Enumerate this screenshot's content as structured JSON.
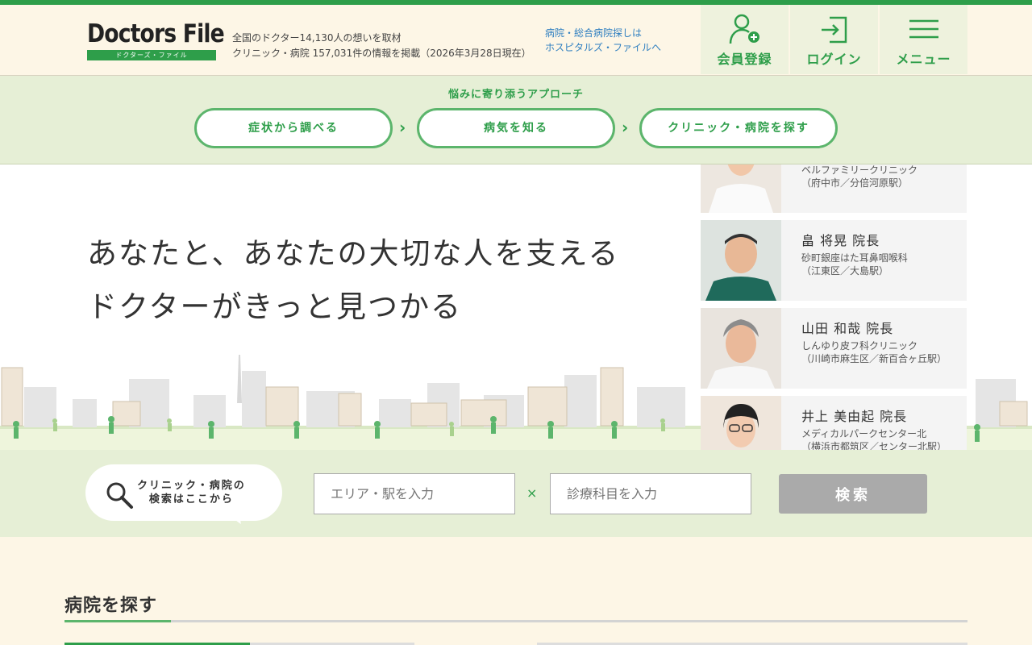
{
  "colors": {
    "brand_green": "#2e9e4a",
    "light_green": "#e6efd6",
    "cream": "#fdf6e6",
    "link_blue": "#2f7fc0",
    "disabled_gray": "#aaaaaa"
  },
  "header": {
    "logo_text": "Doctors File",
    "logo_sub": "ドクターズ・ファイル",
    "tagline_line1": "全国のドクター14,130人の想いを取材",
    "tagline_line2": "クリニック・病院 157,031件の情報を掲載（2026年3月28日現在）",
    "hospitals_link_line1": "病院・総合病院探しは",
    "hospitals_link_line2": "ホスピタルズ・ファイルへ",
    "buttons": [
      {
        "label": "会員登録",
        "icon": "user-add-icon"
      },
      {
        "label": "ログイン",
        "icon": "login-icon"
      },
      {
        "label": "メニュー",
        "icon": "menu-icon"
      }
    ]
  },
  "approach": {
    "title": "悩みに寄り添うアプローチ",
    "steps": [
      "症状から調べる",
      "病気を知る",
      "クリニック・病院を探す"
    ]
  },
  "hero": {
    "copy_line1": "あなたと、あなたの大切な人を支える",
    "copy_line2": "ドクターがきっと見つかる"
  },
  "doctors": [
    {
      "name": "",
      "clinic": "ベルファミリークリニック",
      "location": "（府中市／分倍河原駅）"
    },
    {
      "name": "畠 将晃 院長",
      "clinic": "砂町銀座はた耳鼻咽喉科",
      "location": "（江東区／大島駅）"
    },
    {
      "name": "山田 和哉 院長",
      "clinic": "しんゆり皮フ科クリニック",
      "location": "（川崎市麻生区／新百合ヶ丘駅）"
    },
    {
      "name": "井上 美由起 院長",
      "clinic": "メディカルパークセンター北",
      "location": "（横浜市都筑区／センター北駅）"
    }
  ],
  "search": {
    "bubble_line1": "クリニック・病院の",
    "bubble_line2": "検索はここから",
    "area_placeholder": "エリア・駅を入力",
    "times_symbol": "×",
    "dept_placeholder": "診療科目を入力",
    "button_label": "検索"
  },
  "section": {
    "title": "病院を探す"
  }
}
